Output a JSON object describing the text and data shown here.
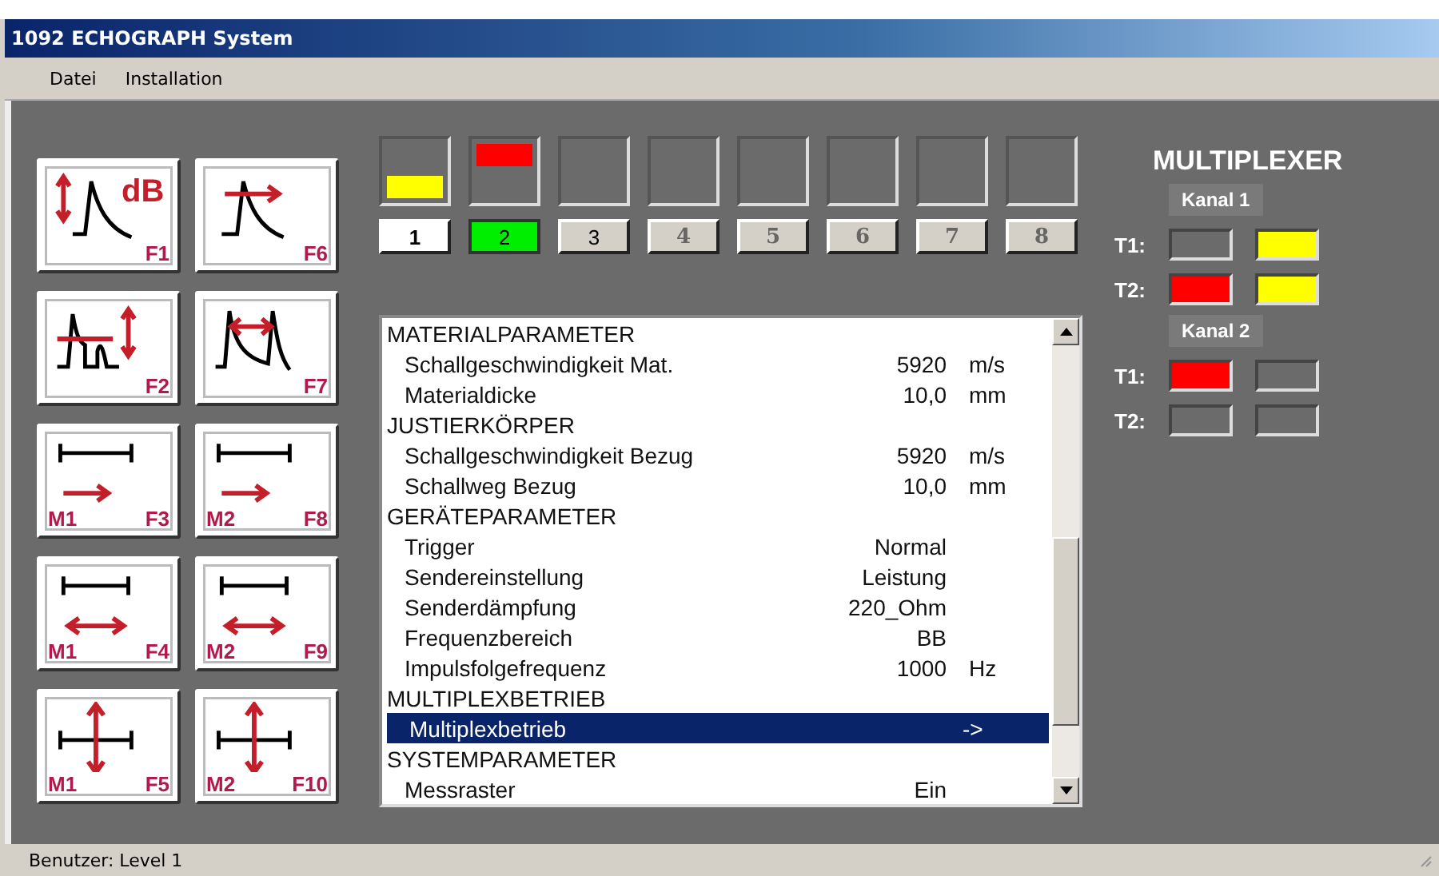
{
  "window": {
    "title": "1092 ECHOGRAPH System"
  },
  "menu": [
    "Datei",
    "Installation"
  ],
  "function_keys": [
    {
      "kind": "gain",
      "badge": "dB",
      "key": "F1"
    },
    {
      "kind": "gate-move",
      "key": "F6"
    },
    {
      "kind": "gate-level",
      "key": "F2"
    },
    {
      "kind": "sound-path",
      "key": "F7"
    },
    {
      "kind": "marker-move",
      "marker": "M1",
      "key": "F3"
    },
    {
      "kind": "marker-move",
      "marker": "M2",
      "key": "F8"
    },
    {
      "kind": "marker-width",
      "marker": "M1",
      "key": "F4"
    },
    {
      "kind": "marker-width",
      "marker": "M2",
      "key": "F9"
    },
    {
      "kind": "marker-height",
      "marker": "M1",
      "key": "F5"
    },
    {
      "kind": "marker-height",
      "marker": "M2",
      "key": "F10"
    }
  ],
  "channels": [
    {
      "number": "1",
      "active": true,
      "selected": false,
      "disabled": false,
      "kind": "lower",
      "color": "#ffff00"
    },
    {
      "number": "2",
      "active": false,
      "selected": true,
      "disabled": false,
      "kind": "upper",
      "color": "#ff0000"
    },
    {
      "number": "3",
      "active": false,
      "selected": false,
      "disabled": false
    },
    {
      "number": "4",
      "active": false,
      "selected": false,
      "disabled": true
    },
    {
      "number": "5",
      "active": false,
      "selected": false,
      "disabled": true
    },
    {
      "number": "6",
      "active": false,
      "selected": false,
      "disabled": true
    },
    {
      "number": "7",
      "active": false,
      "selected": false,
      "disabled": true
    },
    {
      "number": "8",
      "active": false,
      "selected": false,
      "disabled": true
    }
  ],
  "parameters": [
    {
      "kind": "section",
      "label": "MATERIALPARAMETER",
      "selected": false
    },
    {
      "kind": "param",
      "label": "Schallgeschwindigkeit Mat.",
      "value": "5920",
      "unit": "m/s",
      "selected": false
    },
    {
      "kind": "param",
      "label": "Materialdicke",
      "value": "10,0",
      "unit": "mm",
      "selected": false
    },
    {
      "kind": "section",
      "label": "JUSTIERKÖRPER",
      "selected": false
    },
    {
      "kind": "param",
      "label": "Schallgeschwindigkeit Bezug",
      "value": "5920",
      "unit": "m/s",
      "selected": false
    },
    {
      "kind": "param",
      "label": "Schallweg Bezug",
      "value": "10,0",
      "unit": "mm",
      "selected": false
    },
    {
      "kind": "section",
      "label": "GERÄTEPARAMETER",
      "selected": false
    },
    {
      "kind": "param",
      "label": "Trigger",
      "value": "Normal",
      "selected": false
    },
    {
      "kind": "param",
      "label": "Sendereinstellung",
      "value": "Leistung",
      "selected": false
    },
    {
      "kind": "param",
      "label": "Senderdämpfung",
      "value": "220_Ohm",
      "selected": false
    },
    {
      "kind": "param",
      "label": "Frequenzbereich",
      "value": "BB",
      "selected": false
    },
    {
      "kind": "param",
      "label": "Impulsfolgefrequenz",
      "value": "1000",
      "unit": "Hz",
      "selected": false
    },
    {
      "kind": "section",
      "label": "MULTIPLEXBETRIEB",
      "selected": false
    },
    {
      "kind": "param",
      "label": "Multiplexbetrieb",
      "unit": "->",
      "selected": true
    },
    {
      "kind": "section",
      "label": "SYSTEMPARAMETER",
      "selected": false
    },
    {
      "kind": "param",
      "label": "Messraster",
      "value": "Ein",
      "selected": false
    }
  ],
  "multiplexer": {
    "title": "MULTIPLEXER",
    "groups": [
      {
        "label": "Kanal 1",
        "rows": [
          {
            "label": "T1:",
            "cells": [
              {
                "on": false
              },
              {
                "on": true,
                "color": "#ffff00"
              }
            ]
          },
          {
            "label": "T2:",
            "cells": [
              {
                "on": true,
                "color": "#ff0000"
              },
              {
                "on": true,
                "color": "#ffff00"
              }
            ]
          }
        ]
      },
      {
        "label": "Kanal 2",
        "rows": [
          {
            "label": "T1:",
            "cells": [
              {
                "on": true,
                "color": "#ff0000"
              },
              {
                "on": false
              }
            ]
          },
          {
            "label": "T2:",
            "cells": [
              {
                "on": false
              },
              {
                "on": false
              }
            ]
          }
        ]
      }
    ]
  },
  "status_bar": {
    "text": "Benutzer: Level 1"
  }
}
